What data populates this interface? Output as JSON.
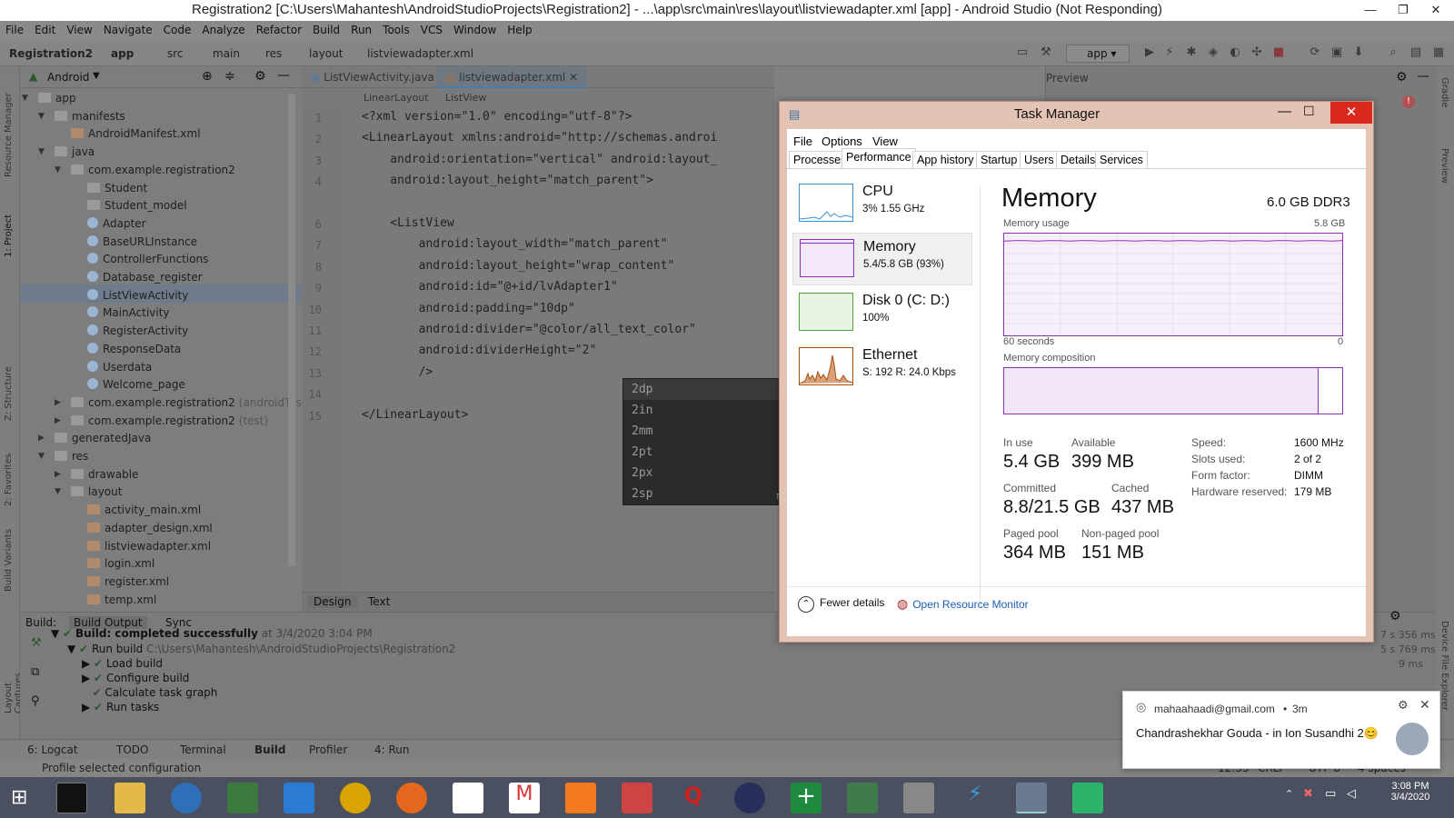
{
  "window": {
    "title": "Registration2 [C:\\Users\\Mahantesh\\AndroidStudioProjects\\Registration2] - ...\\app\\src\\main\\res\\layout\\listviewadapter.xml [app] - Android Studio (Not Responding)"
  },
  "menu": [
    "File",
    "Edit",
    "View",
    "Navigate",
    "Code",
    "Analyze",
    "Refactor",
    "Build",
    "Run",
    "Tools",
    "VCS",
    "Window",
    "Help"
  ],
  "breadcrumbs": [
    "Registration2",
    "app",
    "src",
    "main",
    "res",
    "layout",
    "listviewadapter.xml"
  ],
  "run_config": "app",
  "project": {
    "view": "Android",
    "tree": [
      {
        "label": "app",
        "kind": "folder"
      },
      {
        "label": "manifests",
        "kind": "folder"
      },
      {
        "label": "AndroidManifest.xml",
        "kind": "xml"
      },
      {
        "label": "java",
        "kind": "folder"
      },
      {
        "label": "com.example.registration2",
        "kind": "folder"
      },
      {
        "label": "Student",
        "kind": "folder"
      },
      {
        "label": "Student_model",
        "kind": "folder"
      },
      {
        "label": "Adapter",
        "kind": "class"
      },
      {
        "label": "BaseURLInstance",
        "kind": "class"
      },
      {
        "label": "ControllerFunctions",
        "kind": "class"
      },
      {
        "label": "Database_register",
        "kind": "class"
      },
      {
        "label": "ListViewActivity",
        "kind": "class"
      },
      {
        "label": "MainActivity",
        "kind": "class"
      },
      {
        "label": "RegisterActivity",
        "kind": "class"
      },
      {
        "label": "ResponseData",
        "kind": "class"
      },
      {
        "label": "Userdata",
        "kind": "class"
      },
      {
        "label": "Welcome_page",
        "kind": "class"
      },
      {
        "label": "com.example.registration2",
        "suffix": "(androidTest)",
        "kind": "folder"
      },
      {
        "label": "com.example.registration2",
        "suffix": "(test)",
        "kind": "folder"
      },
      {
        "label": "generatedJava",
        "kind": "folder"
      },
      {
        "label": "res",
        "kind": "folder"
      },
      {
        "label": "drawable",
        "kind": "folder"
      },
      {
        "label": "layout",
        "kind": "folder"
      },
      {
        "label": "activity_main.xml",
        "kind": "xml"
      },
      {
        "label": "adapter_design.xml",
        "kind": "xml"
      },
      {
        "label": "listviewadapter.xml",
        "kind": "xml"
      },
      {
        "label": "login.xml",
        "kind": "xml"
      },
      {
        "label": "register.xml",
        "kind": "xml"
      },
      {
        "label": "temp.xml",
        "kind": "xml"
      }
    ]
  },
  "editor": {
    "tabs": [
      "ListViewActivity.java",
      "listviewadapter.xml"
    ],
    "crumbs": [
      "LinearLayout",
      "ListView"
    ],
    "lines": [
      "<?xml version=\"1.0\" encoding=\"utf-8\"?>",
      "<LinearLayout xmlns:android=\"http://schemas.androi",
      "    android:orientation=\"vertical\" android:layout_",
      "    android:layout_height=\"match_parent\">",
      "",
      "    <ListView",
      "        android:layout_width=\"match_parent\"",
      "        android:layout_height=\"wrap_content\"",
      "        android:id=\"@+id/lvAdapter1\"",
      "        android:padding=\"10dp\"",
      "        android:divider=\"@color/all_text_color\"",
      "        android:dividerHeight=\"2\"",
      "        />",
      "",
      "</LinearLayout>"
    ],
    "line_numbers": [
      "1",
      "2",
      "3",
      "4",
      "6",
      "7",
      "8",
      "9",
      "10",
      "11",
      "12",
      "13",
      "14",
      "15"
    ],
    "autocomplete": [
      "2dp",
      "2in",
      "2mm",
      "2pt",
      "2px",
      "2sp"
    ],
    "autocomplete_footer": "π",
    "bottom_tabs": [
      "Design",
      "Text"
    ]
  },
  "preview_label": "Preview",
  "build": {
    "tabs": [
      "Build:",
      "Build Output",
      "Sync"
    ],
    "items": [
      {
        "text": "Build: completed successfully",
        "detail": "at 3/4/2020 3:04 PM"
      },
      {
        "text": "Run build",
        "detail": "C:\\Users\\Mahantesh\\AndroidStudioProjects\\Registration2"
      },
      {
        "text": "Load build"
      },
      {
        "text": "Configure build"
      },
      {
        "text": "Calculate task graph"
      },
      {
        "text": "Run tasks"
      }
    ],
    "times": [
      "7 s 356 ms",
      "5 s 769 ms",
      "9 ms"
    ]
  },
  "toolwindows": [
    "6: Logcat",
    "TODO",
    "Terminal",
    "Build",
    "Profiler",
    "4: Run"
  ],
  "statusbar": {
    "left": "Profile selected configuration",
    "right": [
      "12:33",
      "CRLF",
      "UTF-8",
      "4 spaces"
    ]
  },
  "side_labels": {
    "left": [
      "Resource Manager",
      "1: Project",
      "Z: Structure",
      "2: Favorites",
      "Build Variants",
      "Layout Captures"
    ],
    "right": [
      "Gradle",
      "Preview",
      "Device File Explorer"
    ]
  },
  "taskmgr": {
    "title": "Task Manager",
    "menu": [
      "File",
      "Options",
      "View"
    ],
    "tabs": [
      "Processes",
      "Performance",
      "App history",
      "Startup",
      "Users",
      "Details",
      "Services"
    ],
    "active_tab": "Performance",
    "resources": [
      {
        "name": "CPU",
        "value": "3%  1.55 GHz",
        "color": "#3c8fd0"
      },
      {
        "name": "Memory",
        "value": "5.4/5.8 GB (93%)",
        "color": "#8b2fb8"
      },
      {
        "name": "Disk 0 (C: D:)",
        "value": "100%",
        "color": "#4da83a"
      },
      {
        "name": "Ethernet",
        "value": "S: 192  R: 24.0 Kbps",
        "color": "#a74f0c"
      }
    ],
    "heading": "Memory",
    "spec": "6.0 GB DDR3",
    "usage_label": "Memory usage",
    "usage_max": "5.8 GB",
    "time_left": "60 seconds",
    "time_right": "0",
    "composition_label": "Memory composition",
    "stats": {
      "in_use": {
        "label": "In use",
        "value": "5.4 GB"
      },
      "available": {
        "label": "Available",
        "value": "399 MB"
      },
      "committed": {
        "label": "Committed",
        "value": "8.8/21.5 GB"
      },
      "cached": {
        "label": "Cached",
        "value": "437 MB"
      },
      "paged": {
        "label": "Paged pool",
        "value": "364 MB"
      },
      "nonpaged": {
        "label": "Non-paged pool",
        "value": "151 MB"
      }
    },
    "right_stats": [
      {
        "k": "Speed:",
        "v": "1600 MHz"
      },
      {
        "k": "Slots used:",
        "v": "2 of 2"
      },
      {
        "k": "Form factor:",
        "v": "DIMM"
      },
      {
        "k": "Hardware reserved:",
        "v": "179 MB"
      }
    ],
    "fewer_details": "Fewer details",
    "open_monitor": "Open Resource Monitor",
    "usage_fraction": 0.93
  },
  "notification": {
    "account": "mahaahaadi@gmail.com",
    "age": "3m",
    "message": "Chandrashekhar Gouda - in Ion Susandhi 2😊"
  },
  "clock": {
    "time": "3:08 PM",
    "date": "3/4/2020"
  }
}
